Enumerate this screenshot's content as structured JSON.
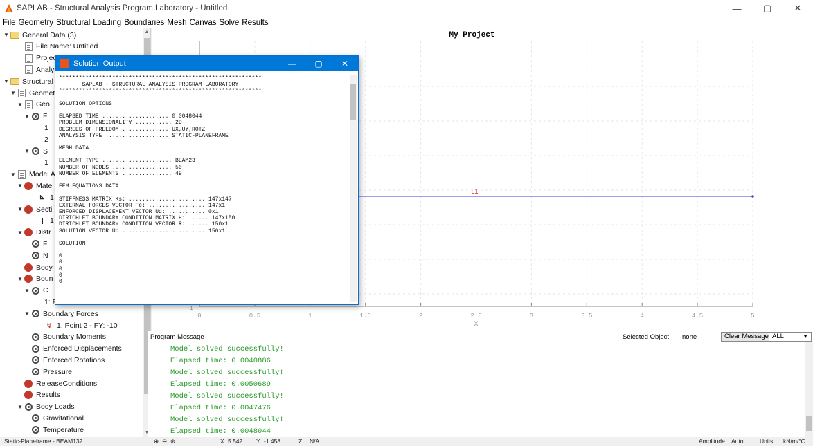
{
  "window": {
    "title": "SAPLAB - Structural Analysis Program Laboratory - Untitled",
    "controls": [
      "—",
      "▢",
      "✕"
    ]
  },
  "menu": [
    "File",
    "Geometry",
    "Structural",
    "Loading",
    "Boundaries",
    "Mesh",
    "Canvas",
    "Solve",
    "Results"
  ],
  "tree": [
    {
      "label": "General Data (3)",
      "icon": "folder-icon",
      "indent": 0,
      "arrow": "▼"
    },
    {
      "label": "File Name: Untitled",
      "icon": "doc-icon",
      "indent": 2,
      "arrow": ""
    },
    {
      "label": "Project T",
      "icon": "doc-icon",
      "indent": 2,
      "arrow": ""
    },
    {
      "label": "Analysis",
      "icon": "doc-icon",
      "indent": 2,
      "arrow": ""
    },
    {
      "label": "Structural M",
      "icon": "folder-icon",
      "indent": 0,
      "arrow": "▼"
    },
    {
      "label": "Geomet",
      "icon": "doc-icon",
      "indent": 1,
      "arrow": "▼"
    },
    {
      "label": "Geo",
      "icon": "doc-icon",
      "indent": 2,
      "arrow": "▼"
    },
    {
      "label": "F",
      "icon": "gear-icon",
      "indent": 3,
      "arrow": "▼"
    },
    {
      "label": "1",
      "icon": "",
      "indent": 5,
      "arrow": ""
    },
    {
      "label": "2",
      "icon": "",
      "indent": 5,
      "arrow": ""
    },
    {
      "label": "S",
      "icon": "gear-icon",
      "indent": 3,
      "arrow": "▼"
    },
    {
      "label": "1",
      "icon": "",
      "indent": 5,
      "arrow": ""
    },
    {
      "label": "Model A",
      "icon": "doc-icon",
      "indent": 1,
      "arrow": "▼"
    },
    {
      "label": "Mate",
      "icon": "red-icon",
      "indent": 2,
      "arrow": "▼"
    },
    {
      "label": "1",
      "icon": "beam-icon",
      "indent": 4,
      "arrow": ""
    },
    {
      "label": "Secti",
      "icon": "red-icon",
      "indent": 2,
      "arrow": "▼"
    },
    {
      "label": "1",
      "icon": "ibeam-icon",
      "indent": 4,
      "arrow": ""
    },
    {
      "label": "Distr",
      "icon": "red-icon",
      "indent": 2,
      "arrow": "▼"
    },
    {
      "label": "F",
      "icon": "gear-icon",
      "indent": 3,
      "arrow": ""
    },
    {
      "label": "N",
      "icon": "gear-icon",
      "indent": 3,
      "arrow": ""
    },
    {
      "label": "Body",
      "icon": "red-icon",
      "indent": 2,
      "arrow": ""
    },
    {
      "label": "Boun",
      "icon": "red-icon",
      "indent": 2,
      "arrow": "▼"
    },
    {
      "label": "C",
      "icon": "gear-icon",
      "indent": 3,
      "arrow": "▼"
    },
    {
      "label": "1: Point 1 - Constraints: RZ",
      "icon": "",
      "indent": 5,
      "arrow": ""
    },
    {
      "label": "Boundary Forces",
      "icon": "gear-icon",
      "indent": 3,
      "arrow": "▼"
    },
    {
      "label": "1: Point 2 - FY: -10",
      "icon": "force-icon",
      "indent": 5,
      "arrow": ""
    },
    {
      "label": "Boundary Moments",
      "icon": "gear-icon",
      "indent": 3,
      "arrow": ""
    },
    {
      "label": "Enforced Displacements",
      "icon": "gear-icon",
      "indent": 3,
      "arrow": ""
    },
    {
      "label": "Enforced Rotations",
      "icon": "gear-icon",
      "indent": 3,
      "arrow": ""
    },
    {
      "label": "Pressure",
      "icon": "gear-icon",
      "indent": 3,
      "arrow": ""
    },
    {
      "label": "ReleaseConditions",
      "icon": "red-icon",
      "indent": 2,
      "arrow": ""
    },
    {
      "label": "Results",
      "icon": "red-icon",
      "indent": 2,
      "arrow": ""
    },
    {
      "label": "Body Loads",
      "icon": "gear-icon",
      "indent": 2,
      "arrow": "▼"
    },
    {
      "label": "Gravitational",
      "icon": "gear-icon",
      "indent": 3,
      "arrow": ""
    },
    {
      "label": "Temperature",
      "icon": "gear-icon",
      "indent": 3,
      "arrow": ""
    }
  ],
  "canvas": {
    "title": "My Project",
    "xlabel": "X",
    "x_ticks": [
      "0",
      "0.5",
      "1",
      "1.5",
      "2",
      "2.5",
      "3",
      "3.5",
      "4",
      "4.5",
      "5"
    ],
    "y_tick_bottom": "-1",
    "line_label": "L1",
    "line_color": "#3f3fe0",
    "label_color": "#e02020"
  },
  "messages": {
    "header_label": "Program Message",
    "selected_label": "Selected Object",
    "selected_value": "none",
    "clear_button": "Clear Messages",
    "filter_value": "ALL",
    "color": "#2b9a2b",
    "lines": [
      "Model solved successfully!",
      "Elapsed time: 0.0040886",
      "Model solved successfully!",
      "Elapsed time: 0.0050689",
      "Model solved successfully!",
      "Elapsed time: 0.0047476",
      "Model solved successfully!",
      "Elapsed time: 0.0048044"
    ]
  },
  "status": {
    "mode": "Static-Planeframe - BEAM132",
    "x_label": "X",
    "x_value": "5.542",
    "y_label": "Y",
    "y_value": "-1.458",
    "z_label": "Z",
    "z_value": "N/A",
    "amplitude_label": "Amplitude",
    "amplitude_value": "Auto",
    "units_label": "Units",
    "units_value": "kN/m/°C"
  },
  "dialog": {
    "title": "Solution Output",
    "lines": [
      "*************************************************************",
      "       SAPLAB - STRUCTURAL ANALYSIS PROGRAM LABORATORY",
      "*************************************************************",
      "",
      "SOLUTION OPTIONS",
      "",
      "ELAPSED TIME .................... 0.0048044",
      "PROBLEM DIMENSIONALITY ........... 2D",
      "DEGREES OF FREEDOM .............. UX,UY,ROTZ",
      "ANALYSIS TYPE ................... STATIC-PLANEFRAME",
      "",
      "MESH DATA",
      "",
      "ELEMENT TYPE ..................... BEAM23",
      "NUMBER OF NODES .................. 50",
      "NUMBER OF ELEMENTS ............... 49",
      "",
      "FEM EQUATIONS DATA",
      "",
      "STIFFNESS MATRIX Ks: ....................... 147x147",
      "EXTERNAL FORCES VECTOR Fe: ................. 147x1",
      "ENFORCED DISPLACEMENT VECTOR Ud: ........... 0x1",
      "DIRICHLET BOUNDARY CONDITION MATRIX H: ...... 147x150",
      "DIRICHLET BOUNDARY CONDITION VECTOR R: ...... 150x1",
      "SOLUTION VECTOR U: ......................... 150x1",
      "",
      "SOLUTION",
      "",
      "0",
      "0",
      "0",
      "0",
      "0"
    ]
  }
}
